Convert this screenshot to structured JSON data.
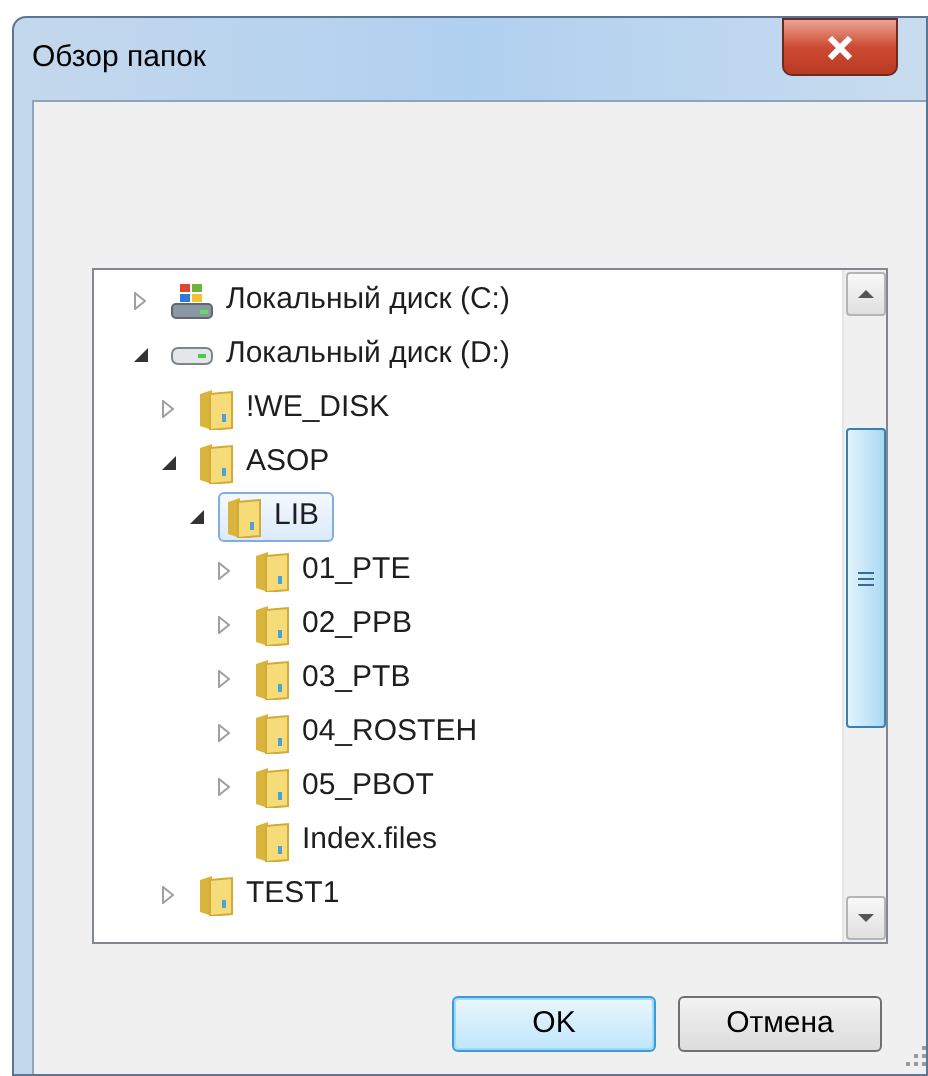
{
  "window": {
    "title": "Обзор папок"
  },
  "tree": [
    {
      "label": "Локальный диск (C:)",
      "kind": "system-drive",
      "expanded": false,
      "selected": false
    },
    {
      "label": "Локальный диск (D:)",
      "kind": "drive",
      "expanded": true,
      "selected": false,
      "children": [
        {
          "label": "!WE_DISK",
          "kind": "folder",
          "expanded": false,
          "selected": false
        },
        {
          "label": "ASOP",
          "kind": "folder",
          "expanded": true,
          "selected": false,
          "children": [
            {
              "label": "LIB",
              "kind": "folder",
              "expanded": true,
              "selected": true,
              "children": [
                {
                  "label": "01_PTE",
                  "kind": "folder",
                  "expanded": false,
                  "selected": false
                },
                {
                  "label": "02_PPB",
                  "kind": "folder",
                  "expanded": false,
                  "selected": false
                },
                {
                  "label": "03_PTB",
                  "kind": "folder",
                  "expanded": false,
                  "selected": false
                },
                {
                  "label": "04_ROSTEH",
                  "kind": "folder",
                  "expanded": false,
                  "selected": false
                },
                {
                  "label": "05_PBOT",
                  "kind": "folder",
                  "expanded": false,
                  "selected": false
                },
                {
                  "label": "Index.files",
                  "kind": "folder",
                  "selected": false
                }
              ]
            }
          ]
        },
        {
          "label": "TEST1",
          "kind": "folder",
          "expanded": false,
          "selected": false
        }
      ]
    }
  ],
  "buttons": [
    {
      "label": "OK",
      "kind": "default"
    },
    {
      "label": "Отмена",
      "kind": "normal"
    }
  ]
}
